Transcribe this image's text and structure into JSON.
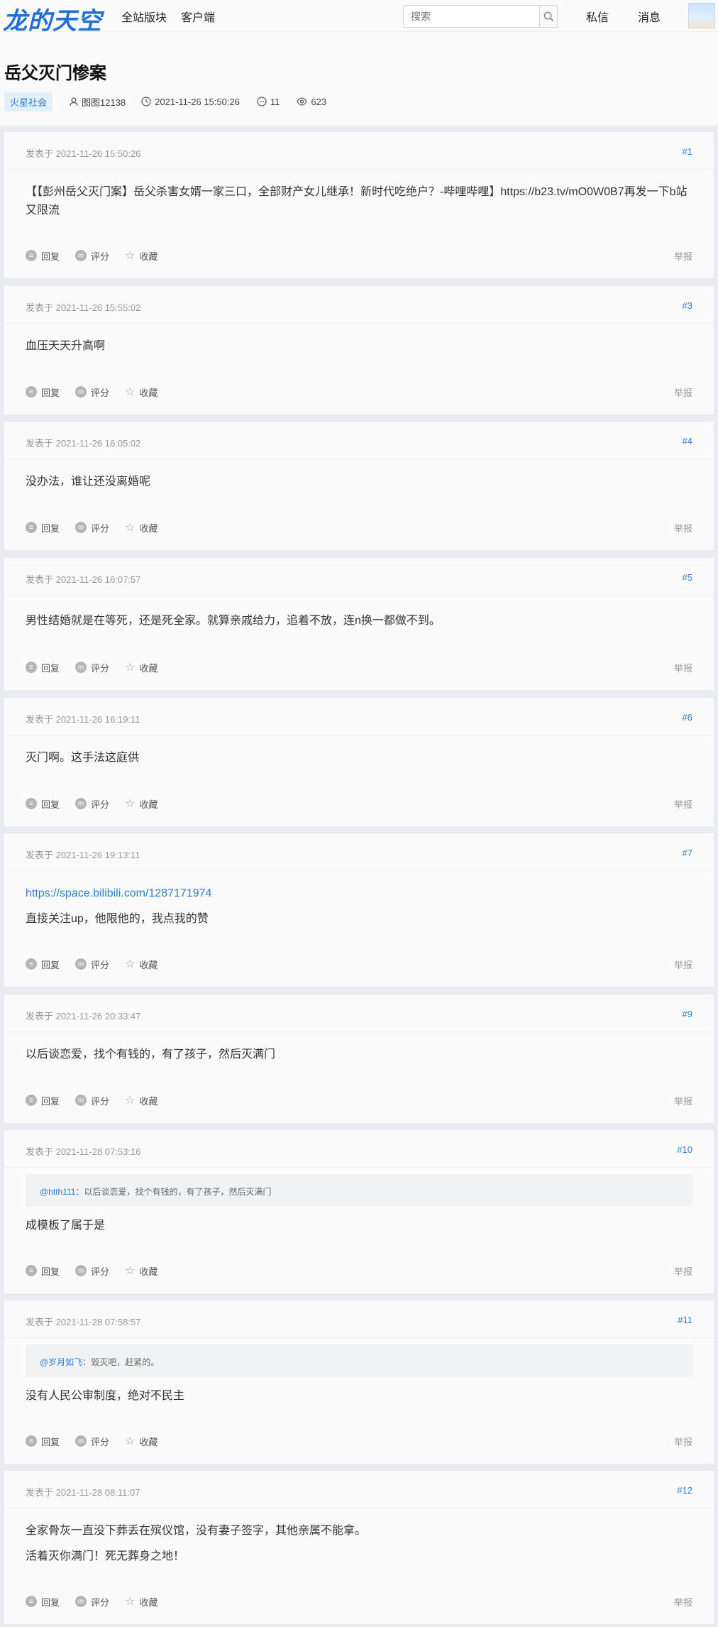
{
  "site": {
    "logo": "龙的天空"
  },
  "nav": [
    "全站版块",
    "客户端"
  ],
  "search": {
    "placeholder": "搜索"
  },
  "topright": {
    "messages": "私信",
    "notifications": "消息"
  },
  "thread": {
    "title": "岳父灭门惨案",
    "tag": "火星社会",
    "author": "图图12138",
    "date": "2021-11-26 15:50:26",
    "replies": "11",
    "views": "623"
  },
  "labels": {
    "reply": "回复",
    "rate": "评分",
    "fav": "收藏",
    "report": "举报",
    "posted_prefix": "发表于 "
  },
  "posts": [
    {
      "time": "2021-11-26 15:50:26",
      "floor": "#1",
      "lines": [
        "【【彭州岳父灭门案】岳父杀害女婿一家三口，全部财产女儿继承！新时代吃绝户？-哔哩哔哩】https://b23.tv/mO0W0B7再发一下b站又限流"
      ]
    },
    {
      "time": "2021-11-26 15:55:02",
      "floor": "#3",
      "lines": [
        "血压天天升高啊"
      ]
    },
    {
      "time": "2021-11-26 16:05:02",
      "floor": "#4",
      "lines": [
        "没办法，谁让还没离婚呢"
      ]
    },
    {
      "time": "2021-11-26 16:07:57",
      "floor": "#5",
      "lines": [
        "男性结婚就是在等死，还是死全家。就算亲戚给力，追着不放，连n换一都做不到。"
      ]
    },
    {
      "time": "2021-11-26 16:19:11",
      "floor": "#6",
      "lines": [
        "灭门啊。这手法这庭供"
      ]
    },
    {
      "time": "2021-11-26 19:13:11",
      "floor": "#7",
      "link": "https://space.bilibili.com/1287171974",
      "lines": [
        "直接关注up，他限他的，我点我的赞"
      ]
    },
    {
      "time": "2021-11-26 20:33:47",
      "floor": "#9",
      "lines": [
        "以后谈恋爱，找个有钱的，有了孩子，然后灭满门"
      ]
    },
    {
      "time": "2021-11-28 07:53:16",
      "floor": "#10",
      "quote_who": "@htth111",
      "quote_text": "：以后谈恋爱，找个有钱的，有了孩子，然后灭满门",
      "lines": [
        "成模板了属于是"
      ]
    },
    {
      "time": "2021-11-28 07:58:57",
      "floor": "#11",
      "quote_who": "@岁月如飞",
      "quote_text": "：毁灭吧，赶紧的。",
      "lines": [
        "没有人民公审制度，绝对不民主"
      ]
    },
    {
      "time": "2021-11-28 08:11:07",
      "floor": "#12",
      "lines": [
        "全家骨灰一直没下葬丢在殡仪馆，没有妻子签字，其他亲属不能拿。",
        "活着灭你满门！死无葬身之地！"
      ]
    }
  ]
}
